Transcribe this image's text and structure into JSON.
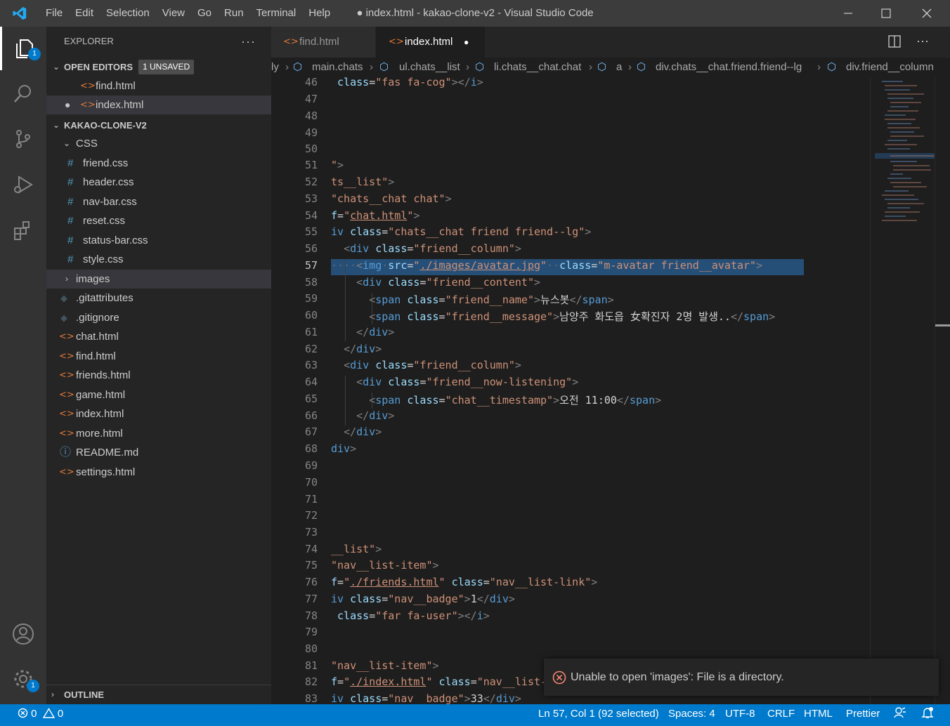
{
  "window": {
    "title": "● index.html - kakao-clone-v2 - Visual Studio Code"
  },
  "menu": [
    "File",
    "Edit",
    "Selection",
    "View",
    "Go",
    "Run",
    "Terminal",
    "Help"
  ],
  "activity": {
    "explorer_badge": "1",
    "settings_badge": "1"
  },
  "sidebar": {
    "title": "EXPLORER",
    "open_editors": {
      "label": "OPEN EDITORS",
      "unsaved": "1 UNSAVED",
      "files": [
        "find.html",
        "index.html"
      ]
    },
    "project": {
      "label": "KAKAO-CLONE-V2",
      "css_folder": "CSS",
      "css_files": [
        "friend.css",
        "header.css",
        "nav-bar.css",
        "reset.css",
        "status-bar.css",
        "style.css"
      ],
      "images_folder": "images",
      "files": [
        ".gitattributes",
        ".gitignore",
        "chat.html",
        "find.html",
        "friends.html",
        "game.html",
        "index.html",
        "more.html",
        "README.md",
        "settings.html"
      ]
    },
    "outline": "OUTLINE"
  },
  "tabs": [
    {
      "label": "find.html"
    },
    {
      "label": "index.html"
    }
  ],
  "breadcrumb": [
    "ly",
    "main.chats",
    "ul.chats__list",
    "li.chats__chat.chat",
    "a",
    "div.chats__chat.friend.friend--lg",
    "div.friend__column"
  ],
  "editor": {
    "line_numbers": [
      "46",
      "47",
      "48",
      "49",
      "50",
      "51",
      "52",
      "53",
      "54",
      "55",
      "56",
      "57",
      "58",
      "59",
      "60",
      "61",
      "62",
      "63",
      "64",
      "65",
      "66",
      "67",
      "68",
      "69",
      "70",
      "71",
      "72",
      "73",
      "74",
      "75",
      "76",
      "77",
      "78",
      "79",
      "80",
      "81",
      "82",
      "83"
    ],
    "text": {
      "news": "뉴스봇",
      "message": "남양주 화도읍 女확진자 2명 발생..",
      "time": "오전 11:00",
      "badge1": "1",
      "badge2": "33"
    }
  },
  "status": {
    "errors": "0",
    "warnings": "0",
    "position": "Ln 57, Col 1 (92 selected)",
    "spaces": "Spaces: 4",
    "encoding": "UTF-8",
    "eol": "CRLF",
    "language": "HTML",
    "formatter": "Prettier"
  },
  "notification": {
    "message": "Unable to open 'images': File is a directory."
  }
}
